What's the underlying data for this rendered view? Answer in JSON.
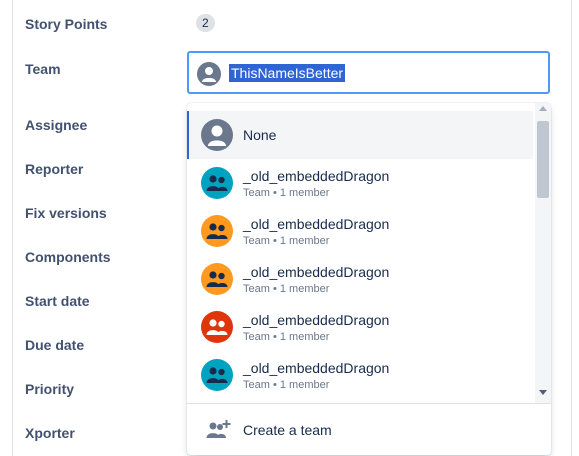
{
  "fields": {
    "story_points_label": "Story Points",
    "story_points_value": "2",
    "team_label": "Team",
    "assignee_label": "Assignee",
    "reporter_label": "Reporter",
    "fix_versions_label": "Fix versions",
    "components_label": "Components",
    "start_date_label": "Start date",
    "due_date_label": "Due date",
    "priority_label": "Priority",
    "xporter_label": "Xporter"
  },
  "team_input": {
    "value": "ThisNameIsBetter",
    "selection_color": "#2e64d4",
    "focus_border_color": "#4c9aff"
  },
  "dropdown": {
    "none_option": {
      "label": "None",
      "icon": "person-placeholder-icon"
    },
    "options": [
      {
        "name": "_old_embeddedDragon",
        "meta": "Team • 1 member",
        "color": "#00a3bf",
        "icon": "team-icon"
      },
      {
        "name": "_old_embeddedDragon",
        "meta": "Team • 1 member",
        "color": "#ff991f",
        "icon": "team-icon"
      },
      {
        "name": "_old_embeddedDragon",
        "meta": "Team • 1 member",
        "color": "#ff991f",
        "icon": "team-icon"
      },
      {
        "name": "_old_embeddedDragon",
        "meta": "Team • 1 member",
        "color": "#de350b",
        "icon": "team-icon"
      },
      {
        "name": "_old_embeddedDragon",
        "meta": "Team • 1 member",
        "color": "#00a3bf",
        "icon": "team-icon"
      }
    ],
    "create_team_label": "Create a team",
    "create_team_icon": "add-team-icon"
  }
}
